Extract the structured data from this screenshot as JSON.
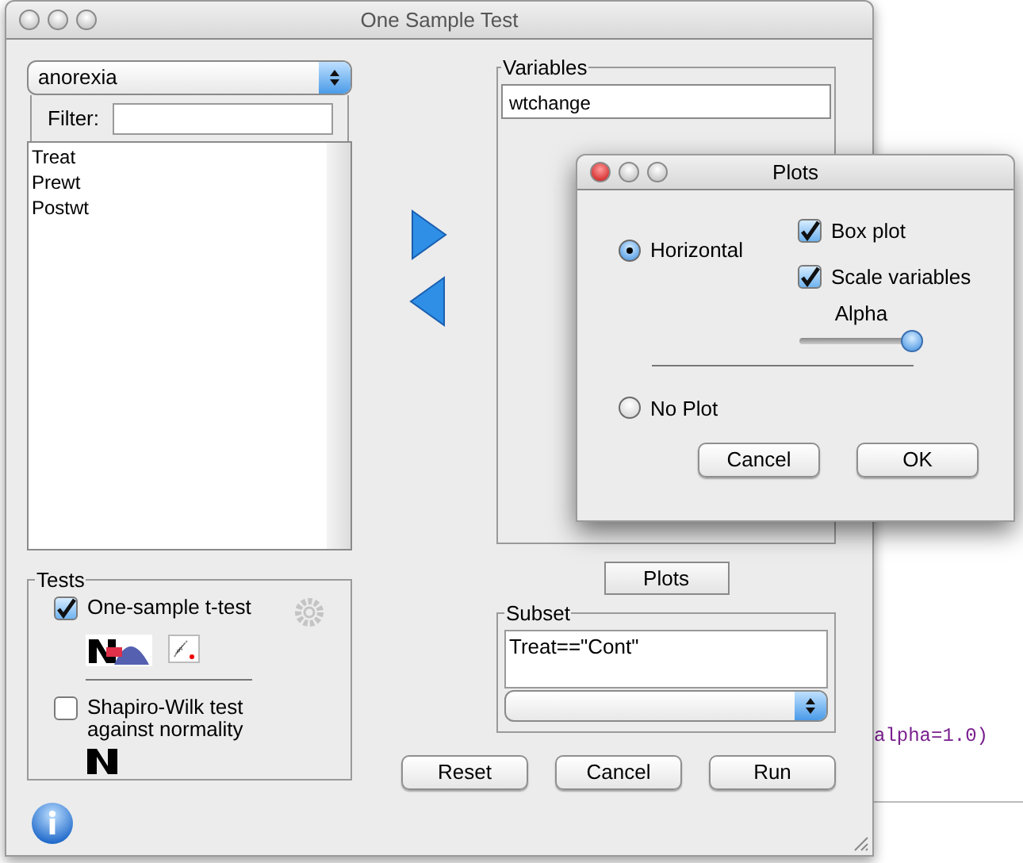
{
  "background_editor": {
    "code_fragment": "alpha=1.0)"
  },
  "window": {
    "title": "One Sample Test"
  },
  "dataset_dropdown": {
    "value": "anorexia"
  },
  "filter": {
    "label": "Filter:"
  },
  "available_variables": [
    "Treat",
    "Prewt",
    "Postwt"
  ],
  "variables": {
    "title": "Variables",
    "items": [
      "wtchange"
    ]
  },
  "tests": {
    "title": "Tests",
    "items": [
      {
        "label": "One-sample t-test",
        "checked": true,
        "kind": "ttest"
      },
      {
        "label": "Shapiro-Wilk test against normality",
        "checked": false,
        "kind": "shapiro"
      }
    ]
  },
  "plots_button": "Plots",
  "subset": {
    "title": "Subset",
    "value": "Treat==\"Cont\""
  },
  "buttons": [
    "Reset",
    "Cancel",
    "Run"
  ],
  "plots_dialog": {
    "title": "Plots",
    "options": [
      {
        "label": "Horizontal",
        "selected": true
      },
      {
        "label": "No Plot",
        "selected": false
      }
    ],
    "checkboxes": [
      {
        "label": "Box plot",
        "checked": true
      },
      {
        "label": "Scale variables",
        "checked": true
      }
    ],
    "alpha": {
      "label": "Alpha",
      "level": 1.0
    },
    "buttons": [
      "Cancel",
      "OK"
    ]
  }
}
